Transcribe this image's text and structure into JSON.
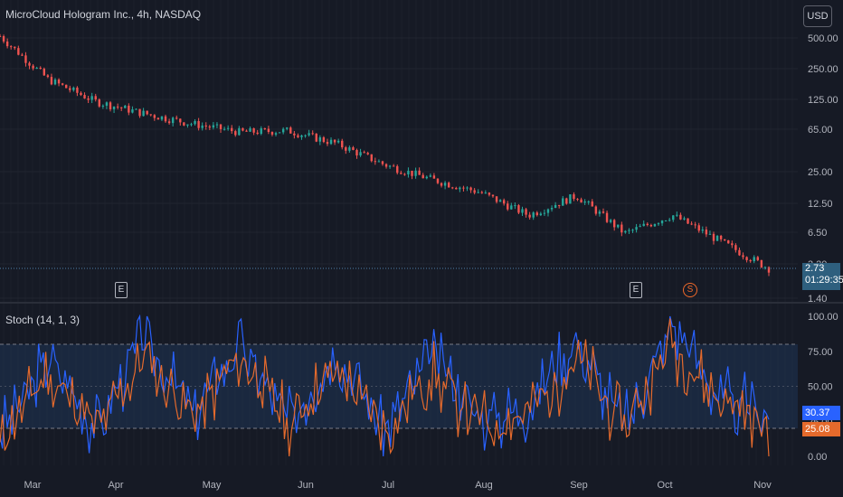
{
  "header": {
    "title": "MicroCloud Hologram Inc., 4h, NASDAQ",
    "currency": "USD"
  },
  "price_axis": {
    "ticks": [
      "500.00",
      "250.00",
      "125.00",
      "65.00",
      "25.00",
      "12.50",
      "6.50",
      "3.20",
      "1.40"
    ]
  },
  "price_tag": {
    "price": "2.73",
    "countdown": "01:29:35"
  },
  "stoch_panel": {
    "title": "Stoch (14, 1, 3)",
    "ticks": [
      "100.00",
      "75.00",
      "50.00",
      "25.00",
      "0.00"
    ],
    "k_value": "30.37",
    "d_value": "25.08",
    "upper_band": 80,
    "lower_band": 20
  },
  "time_axis": {
    "labels": [
      "Mar",
      "Apr",
      "May",
      "Jun",
      "Jul",
      "Aug",
      "Sep",
      "Oct",
      "Nov"
    ]
  },
  "events": [
    {
      "type": "earnings",
      "label": "E",
      "month": "Apr"
    },
    {
      "type": "earnings",
      "label": "E",
      "month": "Sep"
    },
    {
      "type": "split",
      "label": "S",
      "month": "Oct"
    }
  ],
  "colors": {
    "background": "#161a25",
    "grid": "#2a2e39",
    "up": "#26a69a",
    "down": "#ef5350",
    "k_line": "#2962ff",
    "d_line": "#e56a2c",
    "band_fill": "#1e3a5f"
  },
  "chart_data": [
    {
      "type": "line",
      "title": "MicroCloud Hologram Inc., 4h, NASDAQ",
      "scale": "log",
      "ylim": [
        1.4,
        520
      ],
      "x": [
        "Mar",
        "Mar",
        "Apr",
        "Apr",
        "May",
        "May",
        "Jun",
        "Jun",
        "Jul",
        "Jul",
        "Aug",
        "Aug",
        "Sep",
        "Sep",
        "Oct",
        "Oct",
        "Nov"
      ],
      "series": [
        {
          "values": [
            500,
            190,
            115,
            88,
            70,
            58,
            60,
            45,
            28,
            20,
            15,
            9,
            14,
            6,
            9,
            5,
            2.73
          ]
        }
      ]
    },
    {
      "type": "line",
      "title": "Stoch (14, 1, 3)",
      "ylim": [
        0,
        100
      ],
      "x": [
        "Mar",
        "Mar",
        "Apr",
        "Apr",
        "May",
        "May",
        "Jun",
        "Jun",
        "Jul",
        "Jul",
        "Aug",
        "Aug",
        "Sep",
        "Sep",
        "Oct",
        "Oct",
        "Nov"
      ],
      "series": [
        {
          "values": [
            15,
            70,
            20,
            85,
            30,
            80,
            25,
            75,
            20,
            70,
            25,
            35,
            85,
            20,
            95,
            40,
            30.37
          ]
        },
        {
          "values": [
            10,
            60,
            18,
            70,
            28,
            72,
            22,
            62,
            18,
            58,
            22,
            30,
            70,
            22,
            80,
            38,
            25.08
          ]
        }
      ]
    }
  ]
}
